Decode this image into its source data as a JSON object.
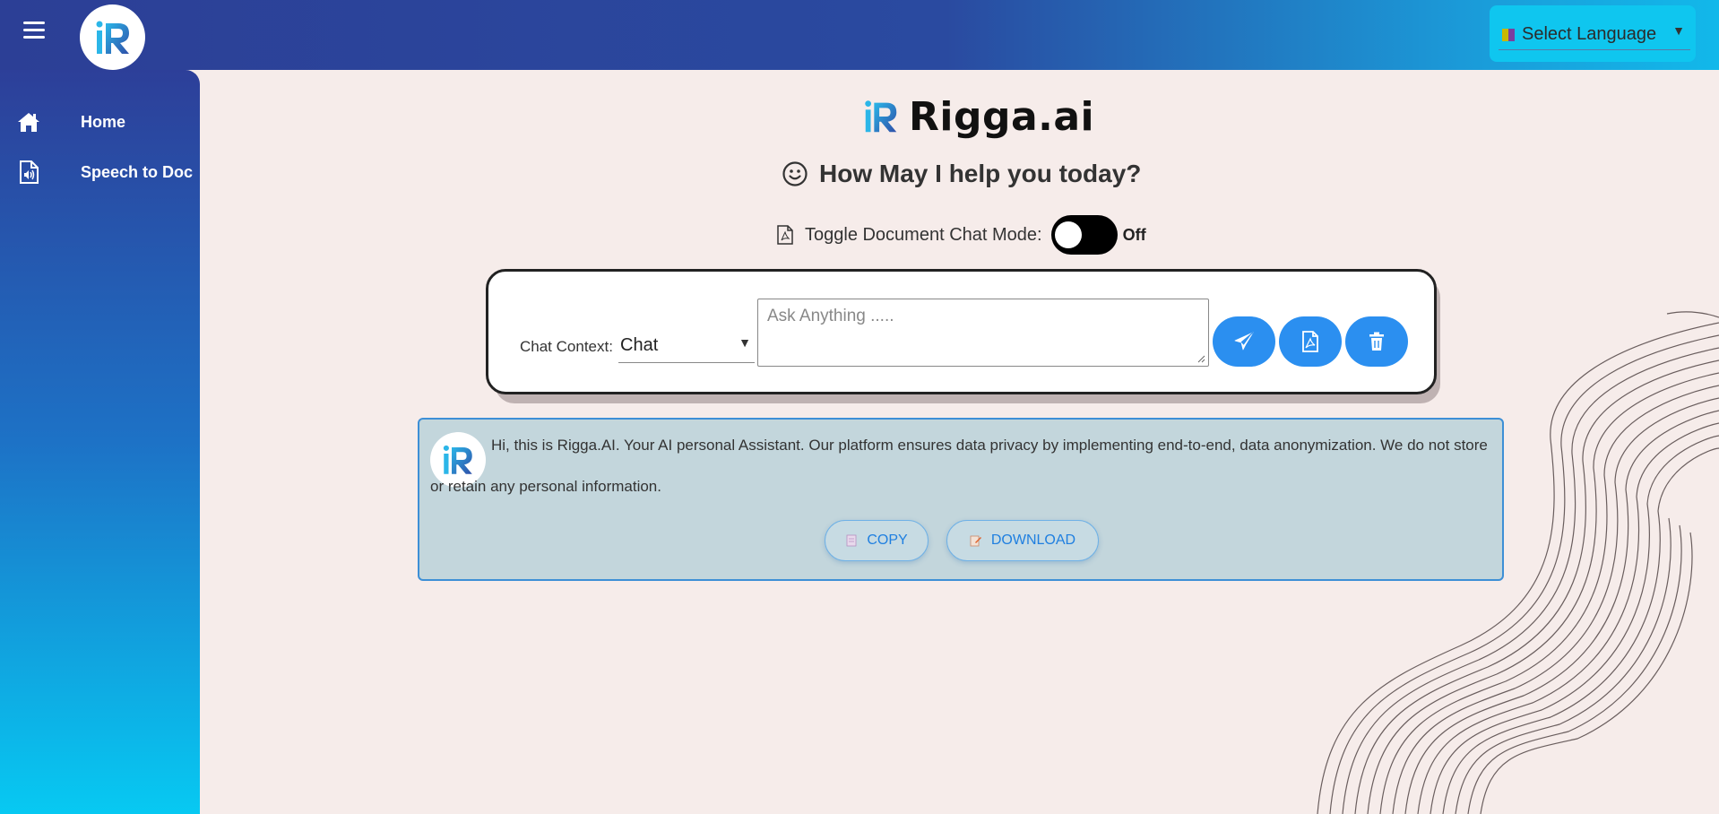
{
  "topbar": {
    "language_select": "Select Language"
  },
  "sidebar": {
    "items": [
      {
        "label": "Home",
        "icon": "home-icon"
      },
      {
        "label": "Speech to Doc",
        "icon": "speech-doc-icon"
      }
    ]
  },
  "brand": {
    "name": "Rigga.ai"
  },
  "greeting": {
    "text": "How May I help you today?"
  },
  "doc_toggle": {
    "label": "Toggle Document Chat Mode:",
    "state": "Off"
  },
  "chat": {
    "context_label": "Chat Context:",
    "context_value": "Chat",
    "input_placeholder": "Ask Anything .....",
    "buttons": [
      "send-icon",
      "pdf-upload-icon",
      "trash-icon"
    ]
  },
  "message": {
    "text": "Hi, this is Rigga.AI. Your AI personal Assistant. Our platform ensures data privacy by implementing end-to-end, data anonymization. We do not store or retain any personal information.",
    "copy_label": "COPY",
    "download_label": "DOWNLOAD"
  },
  "colors": {
    "accent": "#2b8ff0",
    "background": "#f6ecea",
    "message_bg": "#c3d6dc"
  }
}
